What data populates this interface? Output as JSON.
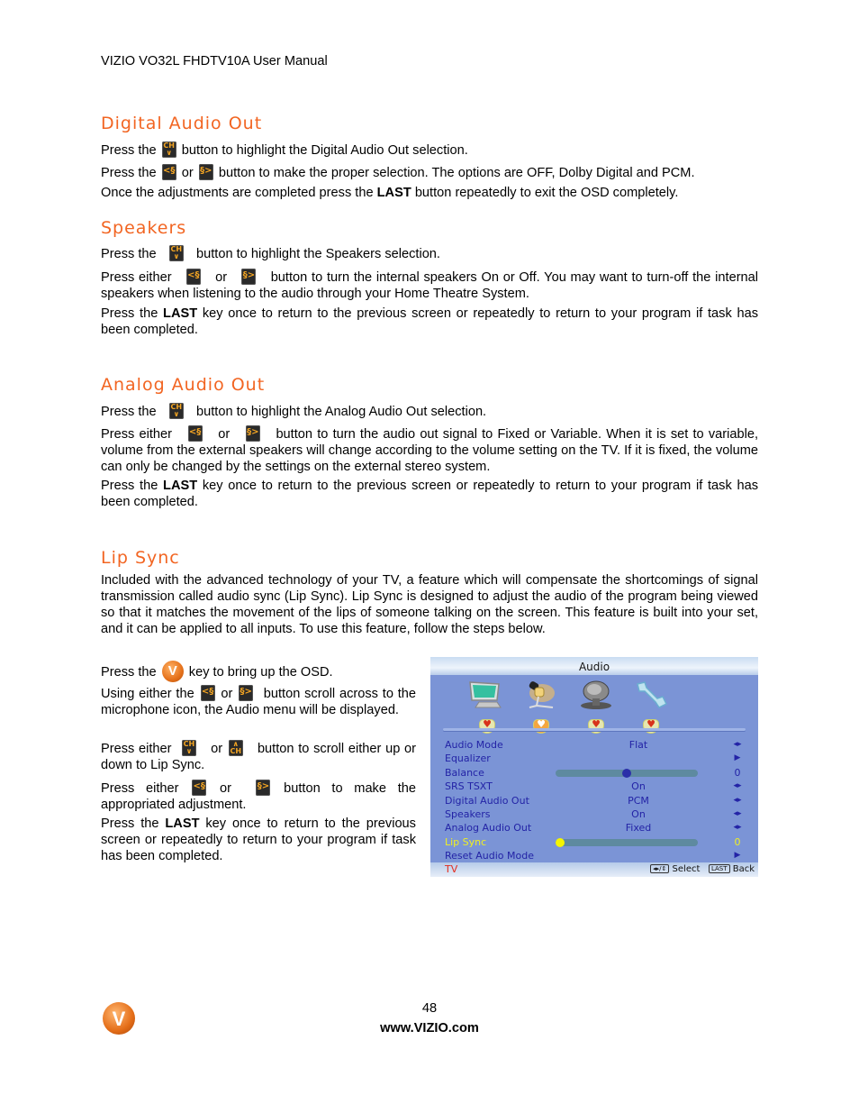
{
  "header": {
    "title": "VIZIO VO32L FHDTV10A User Manual"
  },
  "sections": {
    "digital_audio_out": {
      "heading": "Digital Audio Out",
      "p1_pre": "Press the",
      "p1_post": "button to highlight the Digital Audio Out selection.",
      "p2_pre": "Press the",
      "p2_mid": "or",
      "p2_post": "button to make the proper selection. The options are OFF, Dolby Digital and PCM.",
      "p3_pre": "Once the adjustments are completed press the",
      "p3_bold": "LAST",
      "p3_post": "button repeatedly to exit the OSD completely."
    },
    "speakers": {
      "heading": "Speakers",
      "p1_pre": "Press the",
      "p1_post": "button to highlight the Speakers selection.",
      "p2_pre": "Press either",
      "p2_mid": "or",
      "p2_post": "button to turn the internal speakers On or Off.  You may want to turn-off the internal speakers when listening to the audio through your Home Theatre System.",
      "p3_pre": "Press the",
      "p3_bold": "LAST",
      "p3_post": "key once to return to the previous screen or repeatedly to return to your program if task has been completed."
    },
    "analog_audio_out": {
      "heading": "Analog Audio Out",
      "p1_pre": "Press the",
      "p1_post": "button to highlight the Analog Audio Out selection.",
      "p2_pre": "Press either",
      "p2_mid": "or",
      "p2_post": "button to turn the audio out signal to Fixed or Variable. When it is set to variable, volume from the external speakers will change according to the volume setting on the TV. If it is fixed, the volume can only be changed by the settings on the external stereo system.",
      "p3_pre": "Press the",
      "p3_bold": "LAST",
      "p3_post": "key once to return to the previous screen or repeatedly to return to your program if task has been completed."
    },
    "lip_sync": {
      "heading": "Lip Sync",
      "intro": "Included with the advanced technology of your TV, a feature which will compensate the shortcomings of signal transmission called audio sync (Lip Sync). Lip Sync is designed to adjust the audio of the program being viewed so that it matches the movement of the lips of someone talking on the screen. This feature is built into your set, and it can be applied to all inputs. To use this feature, follow the steps below.",
      "s1_pre": "Press the",
      "s1_post": "key to bring up the OSD.",
      "s2_pre": "Using either the",
      "s2_mid": "or",
      "s2_post": "button scroll across to the microphone icon, the Audio menu will be displayed.",
      "s3_pre": "Press either",
      "s3_mid": "or",
      "s3_post": "button to scroll either up or down to Lip Sync.",
      "s4_pre": "Press either",
      "s4_mid": "or",
      "s4_post": "button to make the appropriated adjustment.",
      "s5_pre": "Press the",
      "s5_bold": "LAST",
      "s5_post": "key once to return to the previous screen or repeatedly to return to your program if task has been completed."
    }
  },
  "osd": {
    "title": "Audio",
    "icons": [
      "tv-picture-icon",
      "microphone-audio-icon",
      "satellite-dish-icon",
      "wrench-settings-icon"
    ],
    "active_icon_index": 1,
    "rows": [
      {
        "label": "Audio Mode",
        "value": "Flat",
        "arrow": "◂▸",
        "type": "value"
      },
      {
        "label": "Equalizer",
        "value": "",
        "arrow": "▶",
        "type": "submenu"
      },
      {
        "label": "Balance",
        "value": "",
        "arrow": "0",
        "type": "slider",
        "slider_fraction": 0.5
      },
      {
        "label": "SRS TSXT",
        "value": "On",
        "arrow": "◂▸",
        "type": "value"
      },
      {
        "label": "Digital Audio Out",
        "value": "PCM",
        "arrow": "◂▸",
        "type": "value"
      },
      {
        "label": "Speakers",
        "value": "On",
        "arrow": "◂▸",
        "type": "value"
      },
      {
        "label": "Analog Audio Out",
        "value": "Fixed",
        "arrow": "◂▸",
        "type": "value"
      },
      {
        "label": "Lip Sync",
        "value": "",
        "arrow": "0",
        "type": "slider",
        "slider_fraction": 0.0,
        "selected": true
      },
      {
        "label": "Reset Audio Mode",
        "value": "",
        "arrow": "▶",
        "type": "submenu"
      }
    ],
    "footer": {
      "source": "TV",
      "select_key": "◂▸/⇕",
      "select_label": "Select",
      "back_key": "LAST",
      "back_label": "Back"
    },
    "colors": {
      "background": "#7b94d6",
      "text": "#2323a6",
      "selected": "#f0f020",
      "source": "#e32c1e"
    }
  },
  "footer": {
    "page_number": "48",
    "website": "www.VIZIO.com"
  },
  "colors": {
    "heading": "#f26522"
  }
}
